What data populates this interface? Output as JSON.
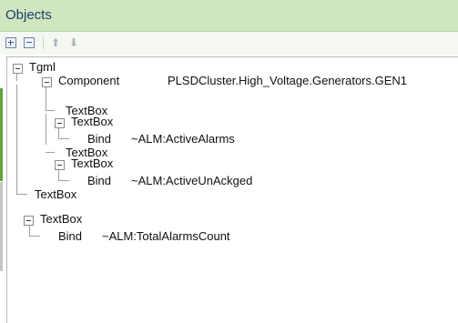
{
  "panel": {
    "title": "Objects"
  },
  "toolbar": {
    "expand_all": "expand-all",
    "collapse_all": "collapse-all",
    "move_up": "up-arrow",
    "move_down": "down-arrow"
  },
  "tree": {
    "root": "Tgml",
    "component_label": "Component",
    "component_value": "PLSDCluster.High_Voltage.Generators.GEN1",
    "textbox1": "TextBox",
    "textbox2": "TextBox",
    "bind1_label": "Bind",
    "bind1_value": "~ALM:ActiveAlarms",
    "textbox3": "TextBox",
    "textbox4": "TextBox",
    "bind2_label": "Bind",
    "bind2_value": "~ALM:ActiveUnAckged",
    "textbox5": "TextBox",
    "textbox6": "TextBox",
    "bind3_label": "Bind",
    "bind3_value": "~ALM:TotalAlarmsCount"
  },
  "colors": {
    "title_bar": "#cfe6bf",
    "title_text": "#1f3d6b",
    "accent_green": "#62a33a"
  }
}
